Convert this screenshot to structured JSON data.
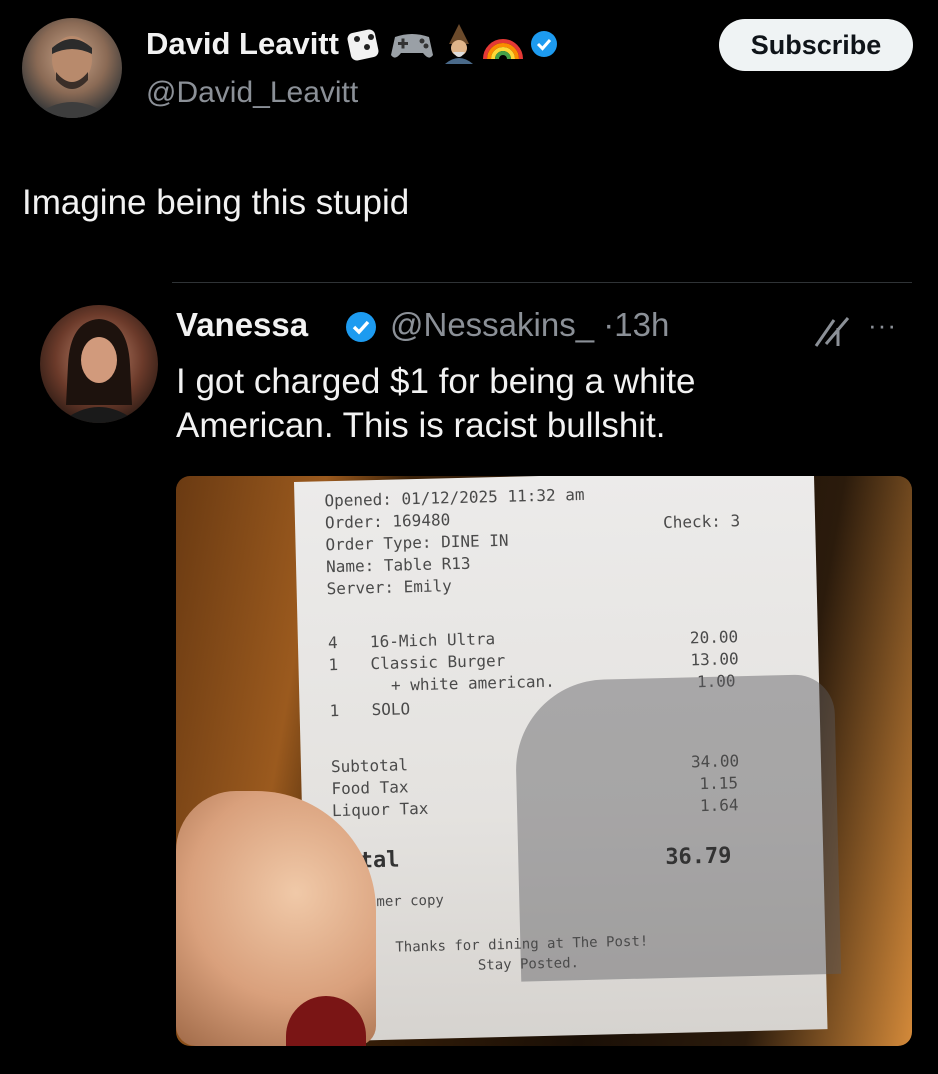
{
  "author": {
    "name": "David Leavitt",
    "handle": "@David_Leavitt",
    "badges": [
      "dice-emoji",
      "game-controller-emoji",
      "wizard-emoji",
      "rainbow-emoji",
      "verified-badge"
    ]
  },
  "subscribe_label": "Subscribe",
  "tweet_text": "Imagine being this stupid",
  "quoted": {
    "name": "Vanessa",
    "handle": "@Nessakins_",
    "time": "·13h",
    "text": "I got charged $1 for being a white American. This is racist bullshit."
  },
  "receipt": {
    "opened": "Opened: 01/12/2025 11:32 am",
    "order": "Order: 169480",
    "order_type": "Order Type: DINE IN",
    "name": "Name: Table R13",
    "server": "Server: Emily",
    "check": "Check: 3",
    "items": [
      {
        "qty": "4",
        "desc": "16-Mich Ultra",
        "price": "20.00"
      },
      {
        "qty": "1",
        "desc": "Classic Burger",
        "price": "13.00"
      },
      {
        "qty": "",
        "desc": "+ white american.",
        "price": "1.00"
      },
      {
        "qty": "1",
        "desc": "SOLO",
        "price": ""
      }
    ],
    "subtotal_label": "Subtotal",
    "subtotal": "34.00",
    "food_tax_label": "Food Tax",
    "food_tax": "1.15",
    "liquor_tax_label": "Liquor Tax",
    "liquor_tax": "1.64",
    "total_label": "Total",
    "total": "36.79",
    "customer_copy": "Customer copy",
    "thanks1": "Thanks for dining at The Post!",
    "thanks2": "Stay Posted."
  },
  "colors": {
    "verified": "#1d9bf0",
    "background": "#000000"
  }
}
